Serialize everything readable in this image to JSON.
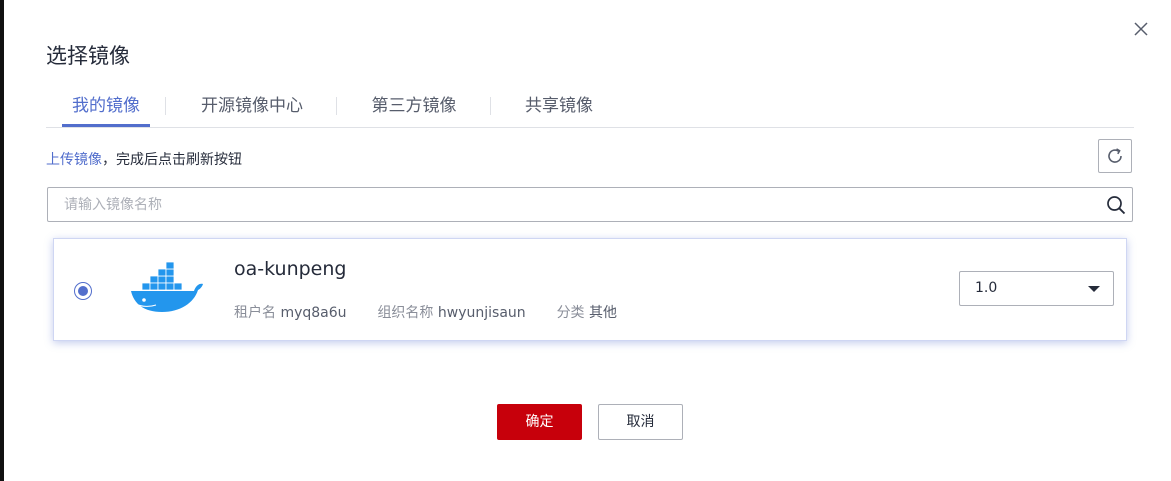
{
  "dialog": {
    "title": "选择镜像"
  },
  "tabs": [
    {
      "label": "我的镜像",
      "active": true
    },
    {
      "label": "开源镜像中心",
      "active": false
    },
    {
      "label": "第三方镜像",
      "active": false
    },
    {
      "label": "共享镜像",
      "active": false
    }
  ],
  "upload": {
    "link_label": "上传镜像",
    "hint": "，完成后点击刷新按钮"
  },
  "search": {
    "placeholder": "请输入镜像名称",
    "value": ""
  },
  "images": [
    {
      "name": "oa-kunpeng",
      "selected": true,
      "tenant_label": "租户名",
      "tenant": "myq8a6u",
      "org_label": "组织名称",
      "org": "hwyunjisaun",
      "category_label": "分类",
      "category": "其他",
      "version": "1.0"
    }
  ],
  "footer": {
    "ok_label": "确定",
    "cancel_label": "取消"
  },
  "colors": {
    "accent": "#526ecc",
    "primary_button": "#c7000b",
    "docker_blue": "#2396ed"
  },
  "icons": [
    "close-icon",
    "refresh-icon",
    "search-icon",
    "docker-icon",
    "chevron-down-icon"
  ]
}
